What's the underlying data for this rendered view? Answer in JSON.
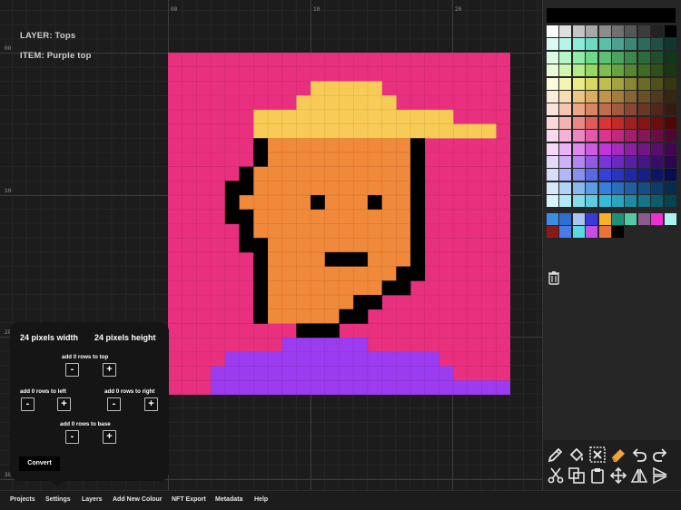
{
  "layer_info": {
    "layer_label": "LAYER: Tops",
    "item_label": "ITEM:  Purple top"
  },
  "ruler": {
    "top_ticks": [
      "00",
      "10",
      "20"
    ],
    "left_ticks": [
      "00",
      "10",
      "20",
      "30"
    ]
  },
  "settings": {
    "width_label": "24 pixels width",
    "height_label": "24 pixels height",
    "add_top_label": "add 0 rows to top",
    "add_left_label": "add 0 rows to left",
    "add_right_label": "add 0 rows to right",
    "add_base_label": "add 0 rows to base",
    "minus": "-",
    "plus": "+",
    "convert_label": "Convert"
  },
  "bottom_nav": [
    "Projects",
    "Settings",
    "Layers",
    "Add New Colour",
    "NFT Export",
    "Metadata",
    "Help"
  ],
  "colors": {
    "background": "#e8307f",
    "hat": "#f7cb56",
    "skin": "#f0893a",
    "outline": "#000000",
    "shirt": "#9b3cf0"
  },
  "pixel_art": {
    "grid_size": 24,
    "legend": {
      ".": "background",
      "Y": "hat",
      "K": "outline",
      "O": "skin",
      "P": "shirt"
    },
    "rows": [
      "........................",
      "........................",
      "..........YYYYY.........",
      ".........YYYYYYY........",
      "......YYYYYYYYYYYYYY....",
      "......YYYYYYYYYYYYYYYYY.",
      "......KOOOOOOOOOOK......",
      "......KOOOOOOOOOOK......",
      ".....KOOOOOOOOOOOK......",
      "....KKOOOOOOOOOOOK......",
      "....KOOOOOKOOOKOOK......",
      "....KKOOOOOOOOOOOK......",
      ".....KOOOOOOOOOOOK......",
      ".....KKOOOOOOOOOOK......",
      "......KOOOOKKKOOOK......",
      "......KOOOOOOOOOKK......",
      "......KOOOOOOOOKK.......",
      "......KOOOOOOKK.........",
      "......KOOOOOKK..........",
      ".........KKK............",
      "........PPPPPP..........",
      "....PPPPPPPPPPPPPPP.....",
      "...PPPPPPPPPPPPPPPPP....",
      "...PPPPPPPPPPPPPPPPPPPPP"
    ]
  },
  "palette": {
    "rows": [
      [
        "#ffffff",
        "#dedede",
        "#c4c4c4",
        "#a8a8a8",
        "#8c8c8c",
        "#707070",
        "#565656",
        "#3c3c3c",
        "#222222",
        "#000000"
      ],
      [
        "#d9fbf4",
        "#b4f5e8",
        "#8decd9",
        "#6fd9c4",
        "#5cbfa9",
        "#4ba38f",
        "#3b8775",
        "#2c6b5c",
        "#1f5045",
        "#123630"
      ],
      [
        "#dcfbe4",
        "#b8f5c6",
        "#90eca5",
        "#6fd98a",
        "#5cbf74",
        "#4ba35f",
        "#3b874c",
        "#2c6b3a",
        "#1f5029",
        "#12361a"
      ],
      [
        "#eafbd9",
        "#d2f5b2",
        "#b4ec87",
        "#95d962",
        "#7cbf4f",
        "#67a340",
        "#538732",
        "#406b25",
        "#2e501a",
        "#1e3610"
      ],
      [
        "#fbfbd9",
        "#f5f5b2",
        "#ecec87",
        "#d9d962",
        "#bfbf4f",
        "#a3a340",
        "#878732",
        "#6b6b25",
        "#50501a",
        "#363610"
      ],
      [
        "#fbeed9",
        "#f5dcb2",
        "#ecc687",
        "#d9ad62",
        "#bf944f",
        "#a37c40",
        "#876532",
        "#6b4f25",
        "#503a1a",
        "#362610"
      ],
      [
        "#fbe3d9",
        "#f5c6b2",
        "#eca587",
        "#d98562",
        "#bf6d4f",
        "#a35a40",
        "#874732",
        "#6b3625",
        "#50281a",
        "#361b10"
      ],
      [
        "#fbd9d9",
        "#f5b2b2",
        "#ec8787",
        "#e05a5a",
        "#d93535",
        "#bf2a2a",
        "#a31f1f",
        "#871515",
        "#6b0d0d",
        "#500606"
      ],
      [
        "#fbd9ec",
        "#f5b2d9",
        "#ec87c4",
        "#e35aad",
        "#d9358f",
        "#bf2a7c",
        "#a31f69",
        "#871557",
        "#6b0d44",
        "#500632"
      ],
      [
        "#f5d9fb",
        "#ebb2f5",
        "#de87ec",
        "#cf5ae3",
        "#c135d9",
        "#a72abf",
        "#8d1fa3",
        "#741587",
        "#5a0d6b",
        "#410650"
      ],
      [
        "#e6d9fb",
        "#cdb2f5",
        "#b087ec",
        "#935ae3",
        "#7a35d9",
        "#682abf",
        "#571fa3",
        "#471587",
        "#370d6b",
        "#280650"
      ],
      [
        "#d9dcfb",
        "#b2b8f5",
        "#8790ec",
        "#5a67e3",
        "#3540d9",
        "#2a35bf",
        "#1f29a3",
        "#151f87",
        "#0d156b",
        "#060d50"
      ],
      [
        "#d9e9fb",
        "#b2d3f5",
        "#87b9ec",
        "#5a9de3",
        "#3581d9",
        "#2a6fbf",
        "#1f5ea3",
        "#154d87",
        "#0d3c6b",
        "#062c50"
      ],
      [
        "#d9f4fb",
        "#b2e9f5",
        "#87dcec",
        "#5acde3",
        "#35bbd9",
        "#2aa4bf",
        "#1f8ba3",
        "#157487",
        "#0d5c6b",
        "#064450"
      ],
      [
        "#3b8ee6",
        "#2f6fd1",
        "#a9c3f2",
        "#3a3ad9",
        "#f7b12b",
        "#1f8f7a",
        "#52c9a3",
        "#8c5a8c",
        "#ec2fd2",
        "#a8f5f0"
      ],
      [
        "#8c1a14",
        "#4a7be8",
        "#5ad9e3",
        "#c64fe3",
        "#e8743a",
        "#000000"
      ]
    ]
  },
  "tools": [
    "pencil-icon",
    "fill-bucket-icon",
    "clear-icon",
    "eraser-icon",
    "undo-icon",
    "redo-icon",
    "scissors-icon",
    "copy-icon",
    "paste-icon",
    "move-icon",
    "flip-horizontal-icon",
    "flip-vertical-icon"
  ]
}
